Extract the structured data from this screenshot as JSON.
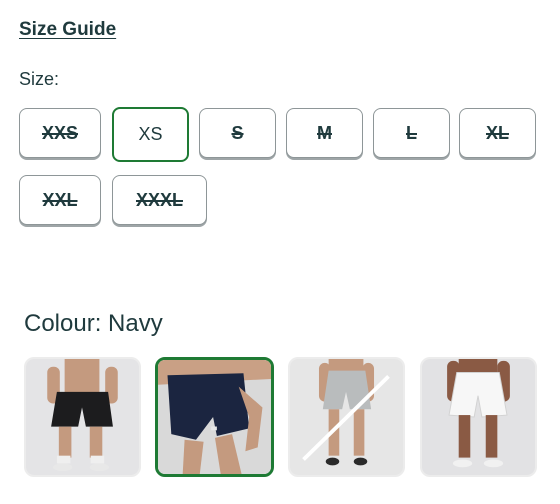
{
  "size_guide_label": "Size Guide",
  "size_label": "Size:",
  "sizes": [
    {
      "label": "XXS",
      "available": false,
      "selected": false
    },
    {
      "label": "XS",
      "available": true,
      "selected": true
    },
    {
      "label": "S",
      "available": false,
      "selected": false
    },
    {
      "label": "M",
      "available": false,
      "selected": false
    },
    {
      "label": "L",
      "available": false,
      "selected": false
    },
    {
      "label": "XL",
      "available": false,
      "selected": false
    },
    {
      "label": "XXL",
      "available": false,
      "selected": false
    },
    {
      "label": "XXXL",
      "available": false,
      "selected": false
    }
  ],
  "colour_label": "Colour: Navy",
  "swatches": [
    {
      "colour": "black",
      "shorts_hex": "#1c1c1e",
      "available": true,
      "selected": false
    },
    {
      "colour": "navy",
      "shorts_hex": "#1b2540",
      "available": true,
      "selected": true
    },
    {
      "colour": "grey",
      "shorts_hex": "#b9bcbd",
      "available": false,
      "selected": false
    },
    {
      "colour": "white",
      "shorts_hex": "#f7f7f7",
      "available": true,
      "selected": false
    }
  ],
  "colors": {
    "selected_border": "#1e7a34",
    "text": "#1f3a3d"
  }
}
